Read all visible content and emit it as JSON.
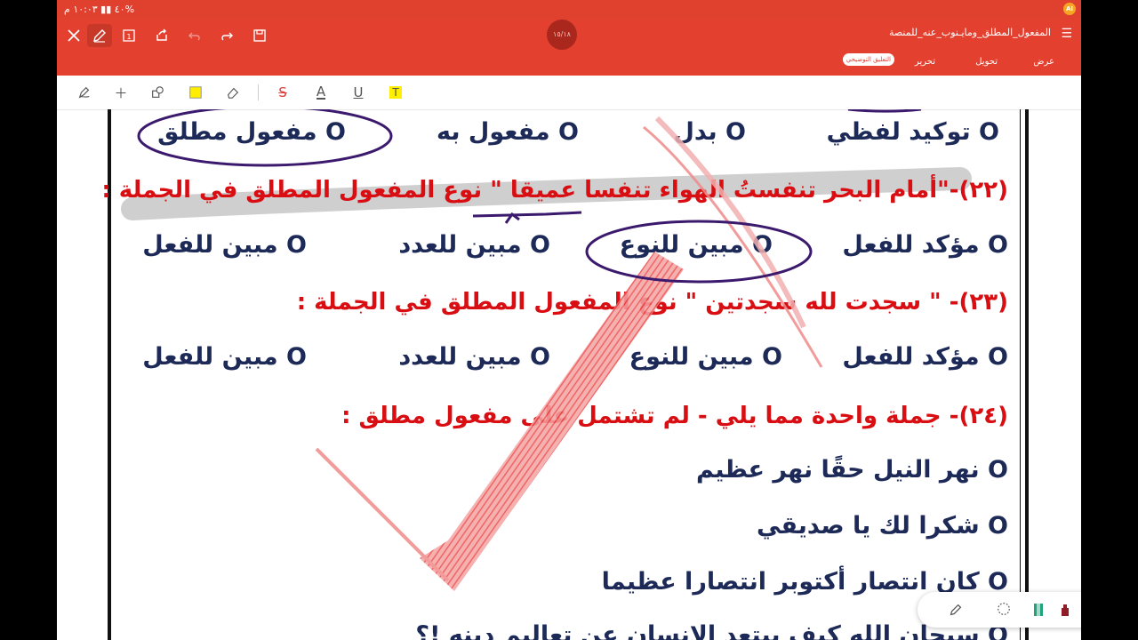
{
  "status_bar": {
    "time": "١٠:٠٣ م",
    "battery": "%٤٠",
    "app_badge": "AI"
  },
  "toolbar": {
    "page_indicator": "١٥/١٨",
    "document_title": "المفعول_المطلق_ومايـنوب_عنه_للمنصة",
    "tabs": [
      {
        "label": "عرض"
      },
      {
        "label": "تحويل"
      },
      {
        "label": "تحرير"
      },
      {
        "label": "التعليق التوضيحي"
      }
    ],
    "page_box": "1"
  },
  "colors": {
    "toolbar": "#e4402f",
    "question": "#d80e12",
    "option": "#1d2a58",
    "highlight_yellow": "#ffee00",
    "annotation_purple": "#3b1a6e",
    "check_red": "#f23a3a"
  },
  "document": {
    "lines": [
      {
        "text": "O توكيد لفظي",
        "kind": "opt"
      },
      {
        "text": "O بدل",
        "kind": "opt"
      },
      {
        "text": "O مفعول به",
        "kind": "opt"
      },
      {
        "text": "O مفعول مطلق",
        "kind": "opt"
      },
      {
        "text": "(٢٢)-\"أمام البحر تنفستُ الهواء تنفسا عميقا \" نوع المفعول المطلق في الجملة :",
        "kind": "q"
      },
      {
        "text": "O مؤكد للفعل",
        "kind": "opt"
      },
      {
        "text": "O مبين للنوع",
        "kind": "opt"
      },
      {
        "text": "O مبين للعدد",
        "kind": "opt"
      },
      {
        "text": "O مبين للفعل",
        "kind": "opt"
      },
      {
        "text": "(٢٣)- \" سجدت لله سجدتين \" نوع المفعول المطلق في الجملة :",
        "kind": "q"
      },
      {
        "text": "O مؤكد للفعل",
        "kind": "opt"
      },
      {
        "text": "O مبين للنوع",
        "kind": "opt"
      },
      {
        "text": "O مبين للعدد",
        "kind": "opt"
      },
      {
        "text": "O مبين للفعل",
        "kind": "opt"
      },
      {
        "text": "(٢٤)- جملة واحدة مما يلي - لم تشتمل على مفعول مطلق :",
        "kind": "q"
      },
      {
        "text": "O نهر النيل حقًا نهر عظيم",
        "kind": "opt"
      },
      {
        "text": "O  شكرا لك يا صديقي",
        "kind": "opt"
      },
      {
        "text": "O كان انتصار أكتوبر انتصارا عظيما",
        "kind": "opt"
      },
      {
        "text": "O سبحان الله كيف يبتعد الإنسان عن تعاليم دينه !؟",
        "kind": "opt"
      }
    ]
  }
}
